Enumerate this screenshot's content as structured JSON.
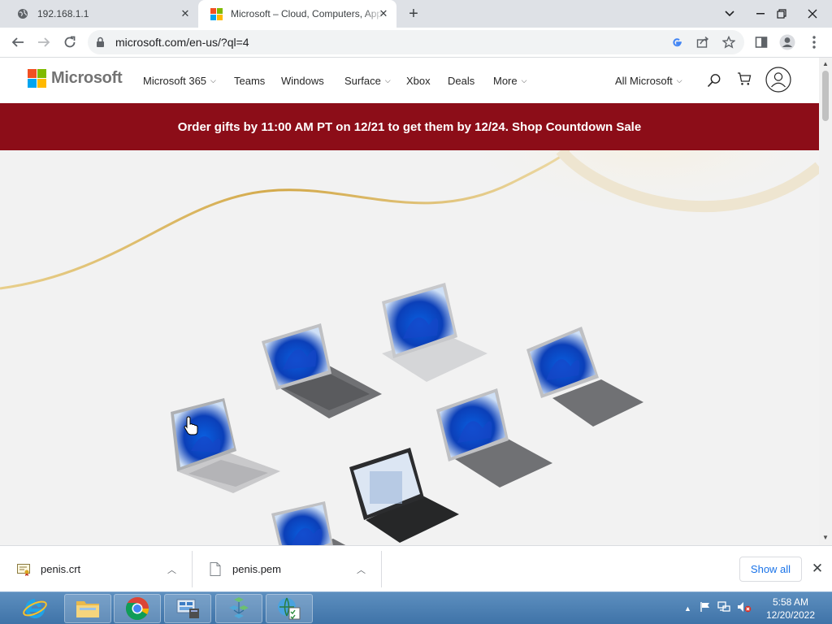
{
  "browser": {
    "tabs": [
      {
        "title": "192.168.1.1",
        "icon": "globe-icon"
      },
      {
        "title": "Microsoft – Cloud, Computers, Apps & Gaming",
        "icon": "microsoft-logo-icon"
      }
    ],
    "new_tab_label": "+",
    "url": "microsoft.com/en-us/?ql=4"
  },
  "site": {
    "brand": "Microsoft",
    "nav": [
      {
        "label": "Microsoft 365",
        "dropdown": true
      },
      {
        "label": "Teams",
        "dropdown": false
      },
      {
        "label": "Windows",
        "dropdown": false
      },
      {
        "label": "Surface",
        "dropdown": true
      },
      {
        "label": "Xbox",
        "dropdown": false
      },
      {
        "label": "Deals",
        "dropdown": false
      },
      {
        "label": "More",
        "dropdown": true
      }
    ],
    "all_microsoft": "All Microsoft",
    "banner": "Order gifts by 11:00 AM PT on 12/21 to get them by 12/24. Shop Countdown Sale",
    "banner_color": "#8c0d18"
  },
  "downloads": {
    "items": [
      {
        "name": "penis.crt",
        "icon": "certificate-file-icon"
      },
      {
        "name": "penis.pem",
        "icon": "file-icon"
      }
    ],
    "show_all": "Show all"
  },
  "taskbar": {
    "time": "5:58 AM",
    "date": "12/20/2022",
    "apps": [
      "internet-explorer-icon",
      "file-explorer-icon",
      "chrome-icon",
      "server-manager-icon",
      "network-icon",
      "task-scheduler-icon"
    ]
  }
}
